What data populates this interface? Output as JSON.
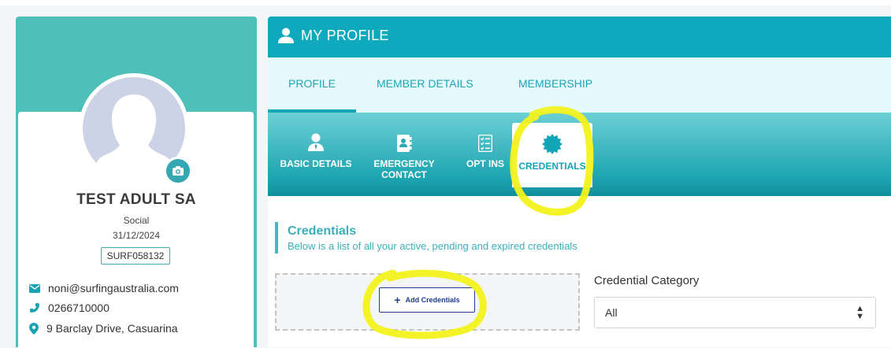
{
  "profile": {
    "name": "TEST ADULT SA",
    "type": "Social",
    "date": "31/12/2024",
    "member_id": "SURF058132",
    "email": "noni@surfingaustralia.com",
    "phone": "0266710000",
    "address": "9 Barclay Drive, Casuarina"
  },
  "panel": {
    "title": "MY PROFILE",
    "tabs": [
      {
        "label": "PROFILE",
        "active": true
      },
      {
        "label": "MEMBER DETAILS",
        "active": false
      },
      {
        "label": "MEMBERSHIP",
        "active": false
      }
    ],
    "subnav": [
      {
        "label": "BASIC DETAILS",
        "icon": "user-tie-icon",
        "active": false
      },
      {
        "label": "EMERGENCY CONTACT",
        "icon": "address-book-icon",
        "active": false
      },
      {
        "label": "OPT INS",
        "icon": "checklist-icon",
        "active": false
      },
      {
        "label": "CREDENTIALS",
        "icon": "certificate-badge-icon",
        "active": true
      }
    ]
  },
  "credentials": {
    "heading": "Credentials",
    "subheading": "Below is a list of all your active, pending and expired credentials",
    "add_button": "Add Credentials",
    "category_label": "Credential Category",
    "category_value": "All"
  },
  "colors": {
    "teal_header": "#0fa9bd",
    "card_teal": "#4fc0b9",
    "tab_bg": "#e6fafd",
    "highlight": "#f2f21c"
  }
}
